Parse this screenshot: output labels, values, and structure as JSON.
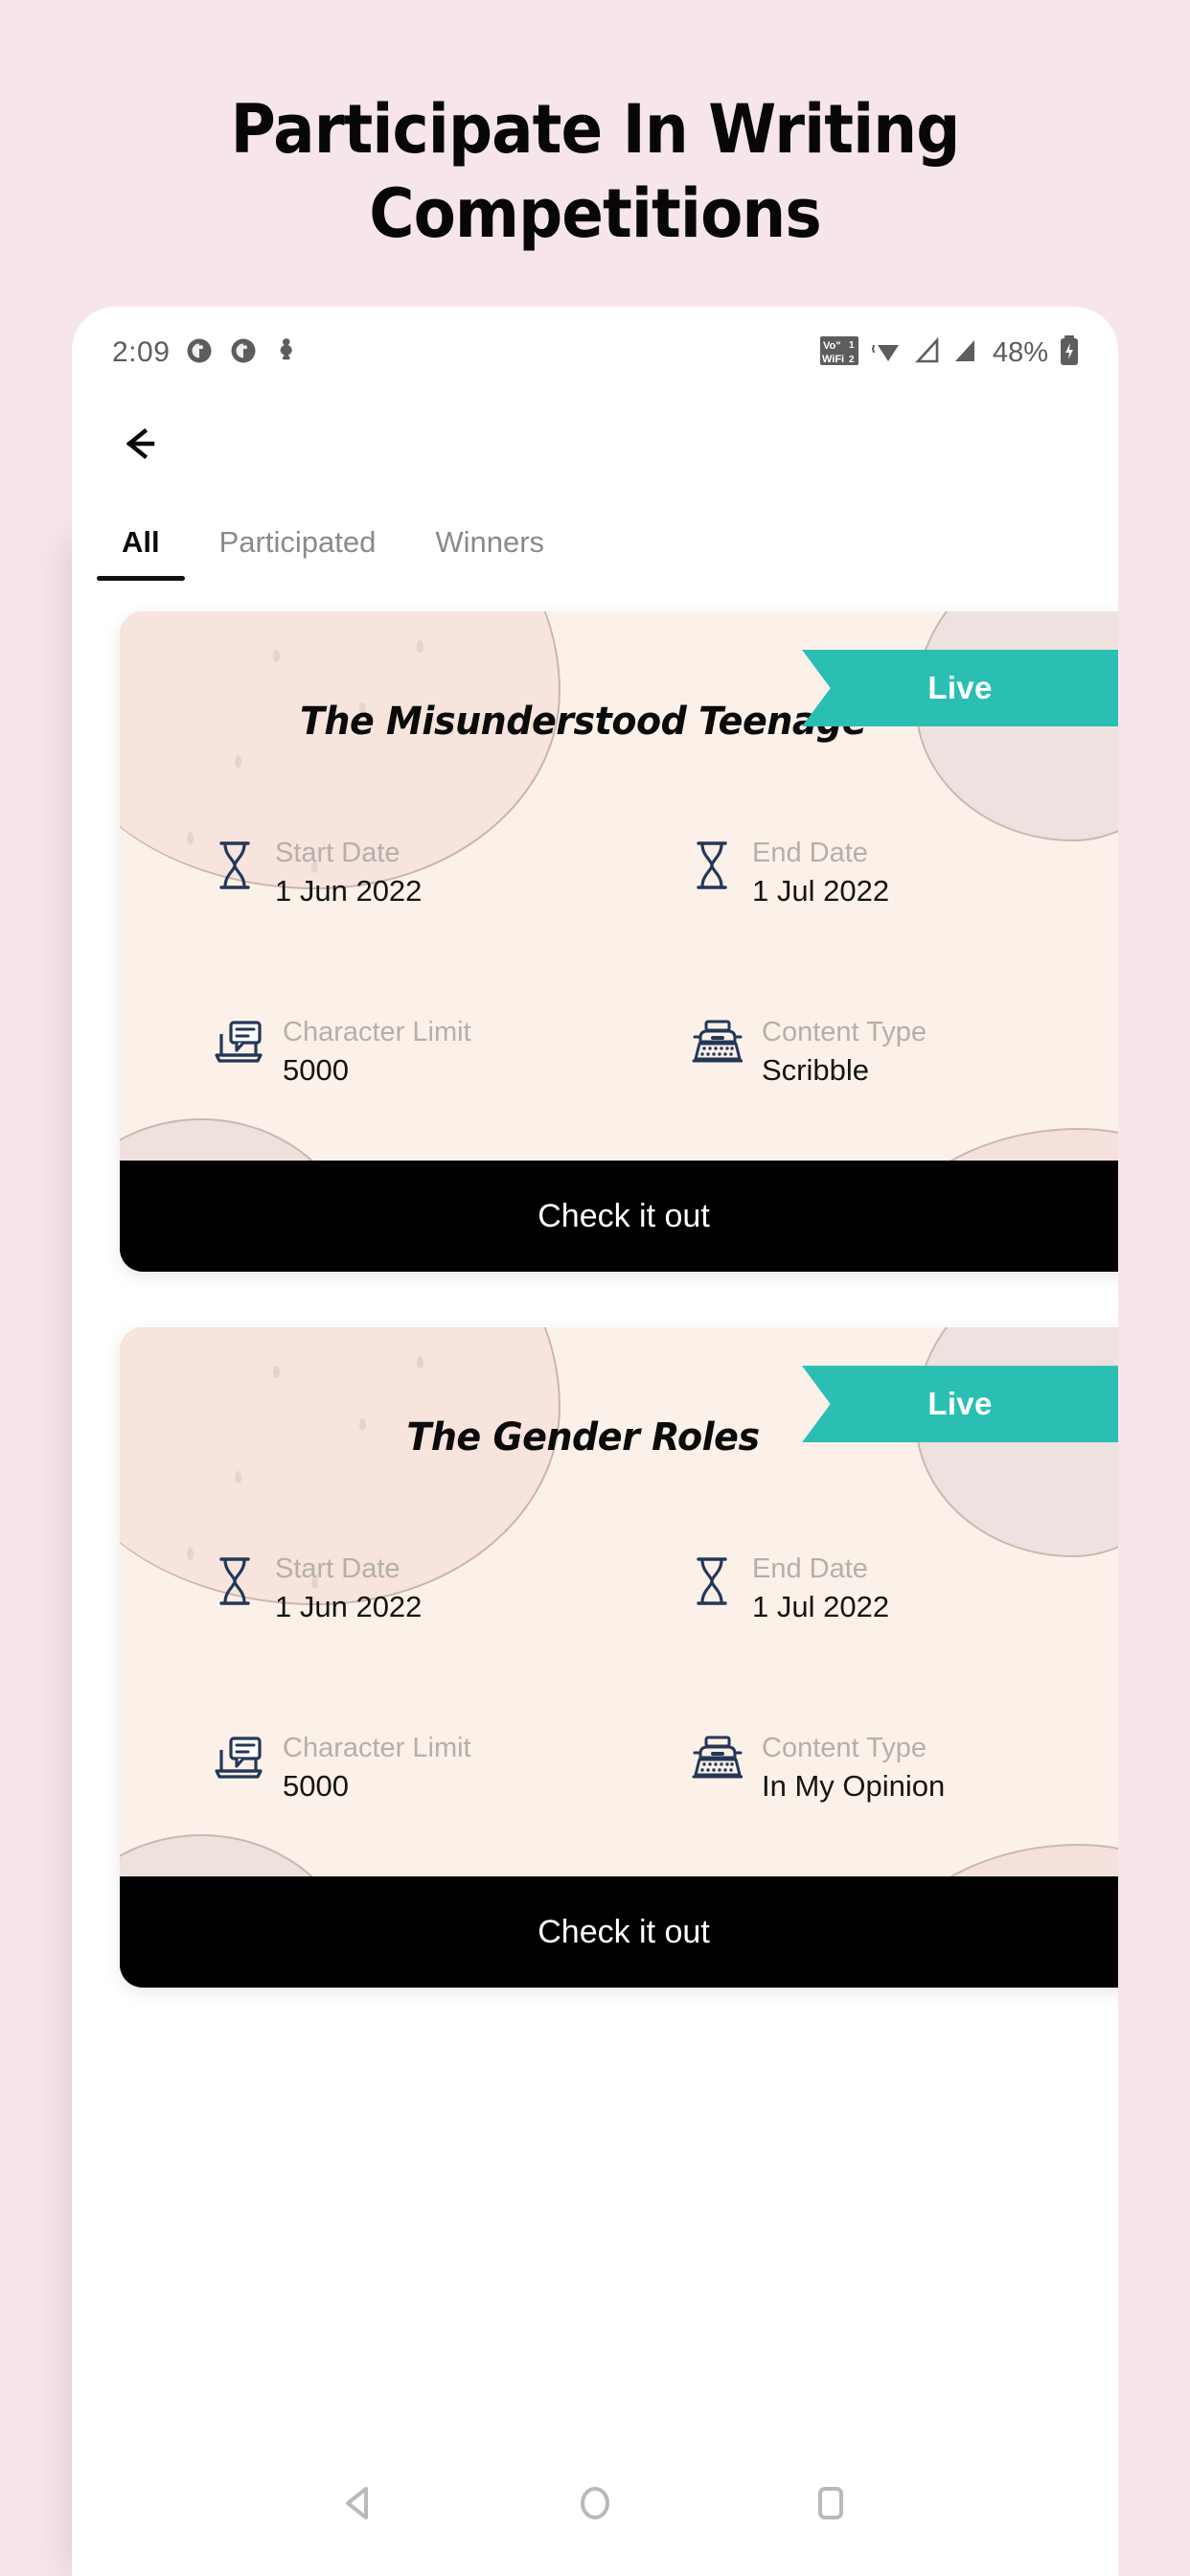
{
  "promo": {
    "line1": "Participate In Writing",
    "line2": "Competitions"
  },
  "colors": {
    "page_background": "#f7e5ec",
    "accent_teal": "#2bbfb3",
    "card_background": "#fbf1e8",
    "cta_background": "#000000",
    "icon_navy": "#243757"
  },
  "statusbar": {
    "time": "2:09",
    "left_icons": [
      "notification-dot-icon",
      "notification-dot-icon",
      "download-icon"
    ],
    "right_icons": [
      "vowifi-icon",
      "wifi-icon",
      "signal-1-icon",
      "signal-2-icon",
      "battery-icon"
    ],
    "battery_percent": "48%"
  },
  "topbar": {
    "back_icon": "arrow-left-icon"
  },
  "tabs": [
    {
      "label": "All",
      "active": true
    },
    {
      "label": "Participated",
      "active": false
    },
    {
      "label": "Winners",
      "active": false
    }
  ],
  "cards": [
    {
      "badge": "Live",
      "title": "The Misunderstood Teenage",
      "fields": [
        {
          "icon": "hourglass-icon",
          "label": "Start Date",
          "value": "1 Jun 2022"
        },
        {
          "icon": "hourglass-icon",
          "label": "End Date",
          "value": "1 Jul 2022"
        },
        {
          "icon": "laptop-message-icon",
          "label": "Character Limit",
          "value": "5000"
        },
        {
          "icon": "typewriter-icon",
          "label": "Content Type",
          "value": "Scribble"
        }
      ],
      "cta": "Check it out"
    },
    {
      "badge": "Live",
      "title": "The Gender Roles",
      "fields": [
        {
          "icon": "hourglass-icon",
          "label": "Start Date",
          "value": "1 Jun 2022"
        },
        {
          "icon": "hourglass-icon",
          "label": "End Date",
          "value": "1 Jul 2022"
        },
        {
          "icon": "laptop-message-icon",
          "label": "Character Limit",
          "value": "5000"
        },
        {
          "icon": "typewriter-icon",
          "label": "Content Type",
          "value": "In My Opinion"
        }
      ],
      "cta": "Check it out"
    }
  ],
  "navbar": {
    "back": "triangle-back-icon",
    "home": "circle-home-icon",
    "recents": "square-recents-icon"
  }
}
